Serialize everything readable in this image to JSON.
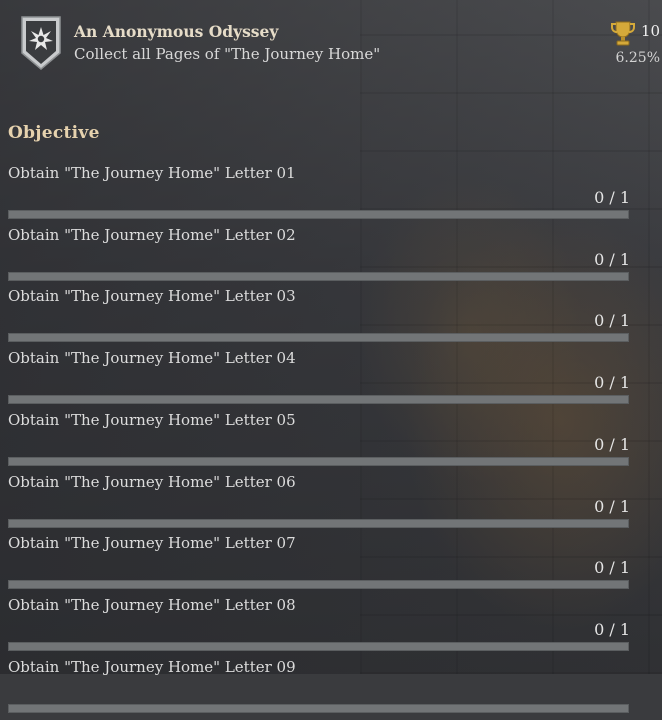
{
  "achievement": {
    "title": "An Anonymous Odyssey",
    "description": "Collect all Pages of \"The Journey Home\"",
    "points": "10",
    "rarity": "6.25%",
    "badge_icon": "shield-star-icon",
    "trophy_icon": "trophy-icon"
  },
  "objectives": {
    "heading": "Objective",
    "items": [
      {
        "label": "Obtain \"The Journey Home\" Letter 01",
        "count": "0 / 1",
        "progress": 0
      },
      {
        "label": "Obtain \"The Journey Home\" Letter 02",
        "count": "0 / 1",
        "progress": 0
      },
      {
        "label": "Obtain \"The Journey Home\" Letter 03",
        "count": "0 / 1",
        "progress": 0
      },
      {
        "label": "Obtain \"The Journey Home\" Letter 04",
        "count": "0 / 1",
        "progress": 0
      },
      {
        "label": "Obtain \"The Journey Home\" Letter 05",
        "count": "0 / 1",
        "progress": 0
      },
      {
        "label": "Obtain \"The Journey Home\" Letter 06",
        "count": "0 / 1",
        "progress": 0
      },
      {
        "label": "Obtain \"The Journey Home\" Letter 07",
        "count": "0 / 1",
        "progress": 0
      },
      {
        "label": "Obtain \"The Journey Home\" Letter 08",
        "count": "0 / 1",
        "progress": 0
      },
      {
        "label": "Obtain \"The Journey Home\" Letter 09",
        "count": "",
        "progress": 0
      }
    ]
  },
  "colors": {
    "title": "#e6dcc8",
    "heading": "#e6d2ae",
    "bar": "#727577",
    "badge": "#c9cbcd"
  }
}
